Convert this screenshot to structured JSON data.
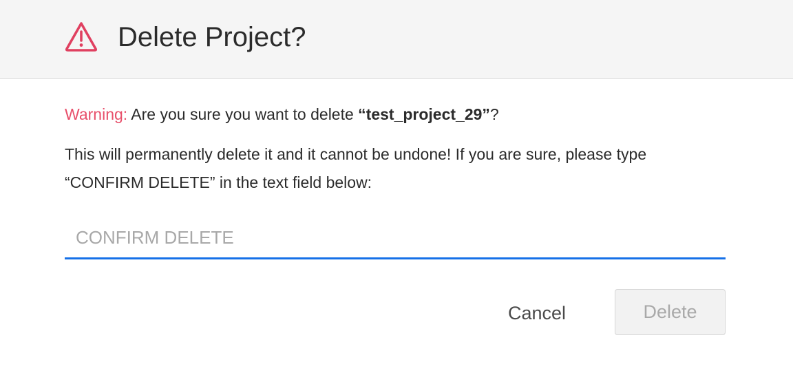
{
  "dialog": {
    "title": "Delete Project?",
    "icon": "warning-triangle-icon",
    "accent_color": "#e04060",
    "warning_label": "Warning:",
    "warning_text_before": " Are you sure you want to delete ",
    "project_name": "“test_project_29”",
    "warning_text_after": "?",
    "info_text": "This will permanently delete it and it cannot be undone! If you are sure, please type “CONFIRM DELETE” in the text field below:",
    "input": {
      "value": "",
      "placeholder": "CONFIRM DELETE",
      "focus_color": "#1570e8"
    },
    "cancel_label": "Cancel",
    "delete_label": "Delete",
    "delete_disabled": true
  }
}
